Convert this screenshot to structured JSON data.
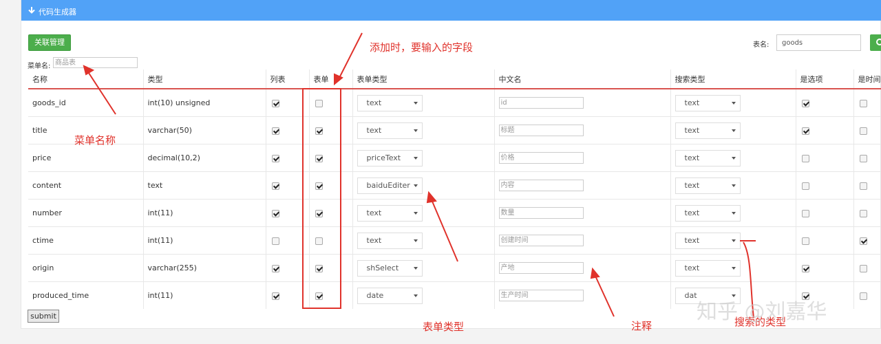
{
  "panel": {
    "title": "代码生成器"
  },
  "toolbar": {
    "relations_button": "关联管理",
    "menu_label": "菜单名:",
    "menu_placeholder": "商品表",
    "table_label": "表名:",
    "table_value": "goods"
  },
  "columns": [
    "名称",
    "类型",
    "列表",
    "表单",
    "表单类型",
    "中文名",
    "搜索类型",
    "是选项",
    "是时间"
  ],
  "rows": [
    {
      "name": "goods_id",
      "type": "int(10) unsigned",
      "list": true,
      "form": false,
      "form_type": "text",
      "cn": "id",
      "search": "text",
      "is_option": true,
      "is_time": false
    },
    {
      "name": "title",
      "type": "varchar(50)",
      "list": true,
      "form": true,
      "form_type": "text",
      "cn": "标题",
      "search": "text",
      "is_option": true,
      "is_time": false
    },
    {
      "name": "price",
      "type": "decimal(10,2)",
      "list": true,
      "form": true,
      "form_type": "priceText",
      "cn": "价格",
      "search": "text",
      "is_option": false,
      "is_time": false
    },
    {
      "name": "content",
      "type": "text",
      "list": true,
      "form": true,
      "form_type": "baiduEditer",
      "cn": "内容",
      "search": "text",
      "is_option": false,
      "is_time": false
    },
    {
      "name": "number",
      "type": "int(11)",
      "list": true,
      "form": true,
      "form_type": "text",
      "cn": "数量",
      "search": "text",
      "is_option": false,
      "is_time": false
    },
    {
      "name": "ctime",
      "type": "int(11)",
      "list": false,
      "form": false,
      "form_type": "text",
      "cn": "创建时间",
      "search": "text",
      "is_option": false,
      "is_time": true
    },
    {
      "name": "origin",
      "type": "varchar(255)",
      "list": true,
      "form": true,
      "form_type": "shSelect",
      "cn": "产地",
      "search": "text",
      "is_option": true,
      "is_time": false
    },
    {
      "name": "produced_time",
      "type": "int(11)",
      "list": true,
      "form": true,
      "form_type": "date",
      "cn": "生产时间",
      "search": "dat",
      "is_option": true,
      "is_time": false
    }
  ],
  "submit_label": "submit",
  "annotations": {
    "add_fields": "添加时，要输入的字段",
    "menu_name": "菜单名称",
    "form_type": "表单类型",
    "comment": "注释",
    "search_type": "搜索的类型"
  },
  "watermark": "知乎 @刘嘉华",
  "colors": {
    "header": "#51a2f7",
    "green": "#4cae4c",
    "annotation": "#e0322b"
  },
  "icons": {
    "collapse": "arrow-down-icon",
    "search": "search-icon"
  }
}
